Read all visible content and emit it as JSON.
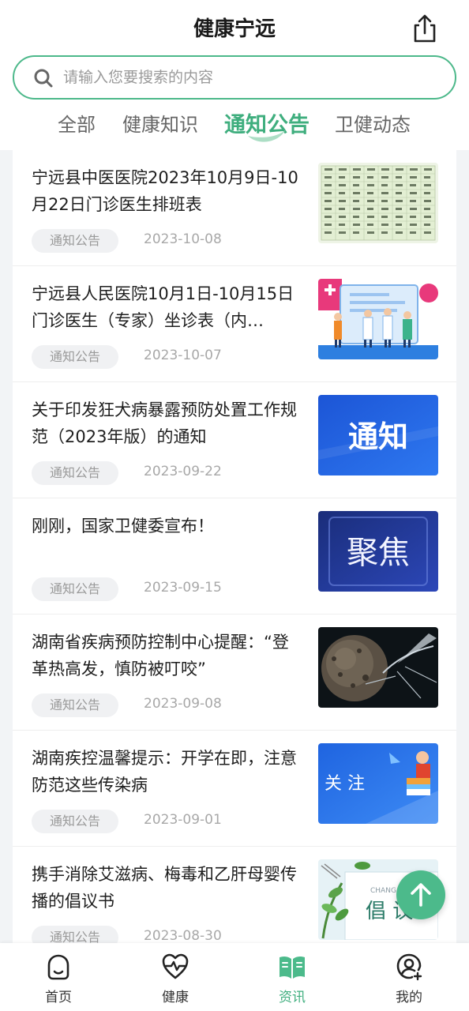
{
  "app": {
    "title": "健康宁远"
  },
  "search": {
    "placeholder": "请输入您要搜索的内容"
  },
  "tabs": [
    {
      "label": "全部",
      "active": false
    },
    {
      "label": "健康知识",
      "active": false
    },
    {
      "label": "通知公告",
      "active": true
    },
    {
      "label": "卫健动态",
      "active": false
    }
  ],
  "articles": [
    {
      "title": "宁远县中医医院2023年10月9日-10月22日门诊医生排班表",
      "tag": "通知公告",
      "date": "2023-10-08",
      "thumb": "schedule-table"
    },
    {
      "title": "宁远县人民医院10月1日-10月15日门诊医生（专家）坐诊表（内…",
      "tag": "通知公告",
      "date": "2023-10-07",
      "thumb": "doctors-illustration"
    },
    {
      "title": "关于印发狂犬病暴露预防处置工作规范（2023年版）的通知",
      "tag": "通知公告",
      "date": "2023-09-22",
      "thumb": "notice-banner",
      "thumb_text": "通知"
    },
    {
      "title": "刚刚，国家卫健委宣布！",
      "tag": "通知公告",
      "date": "2023-09-15",
      "thumb": "focus-banner",
      "thumb_text": "聚焦"
    },
    {
      "title": "湖南省疾病预防控制中心提醒：“登革热高发，慎防被叮咬”",
      "tag": "通知公告",
      "date": "2023-09-08",
      "thumb": "mosquito-photo"
    },
    {
      "title": "湖南疾控温馨提示：开学在即，注意防范这些传染病",
      "tag": "通知公告",
      "date": "2023-09-01",
      "thumb": "attention-banner",
      "thumb_text": "关 注"
    },
    {
      "title": "携手消除艾滋病、梅毒和乙肝母婴传播的倡议书",
      "tag": "通知公告",
      "date": "2023-08-30",
      "thumb": "proposal-banner",
      "thumb_text": "倡 议",
      "thumb_subtext": "CHANG"
    }
  ],
  "fab": {
    "icon": "arrow-up-icon"
  },
  "bottom_nav": [
    {
      "label": "首页",
      "icon": "home-icon",
      "active": false
    },
    {
      "label": "健康",
      "icon": "heart-pulse-icon",
      "active": false
    },
    {
      "label": "资讯",
      "icon": "book-icon",
      "active": true
    },
    {
      "label": "我的",
      "icon": "user-icon",
      "active": false
    }
  ],
  "colors": {
    "accent": "#3fae7e",
    "search_border": "#4cb88a",
    "fab": "#4cba8b",
    "tag_bg": "#f0f1f3"
  }
}
